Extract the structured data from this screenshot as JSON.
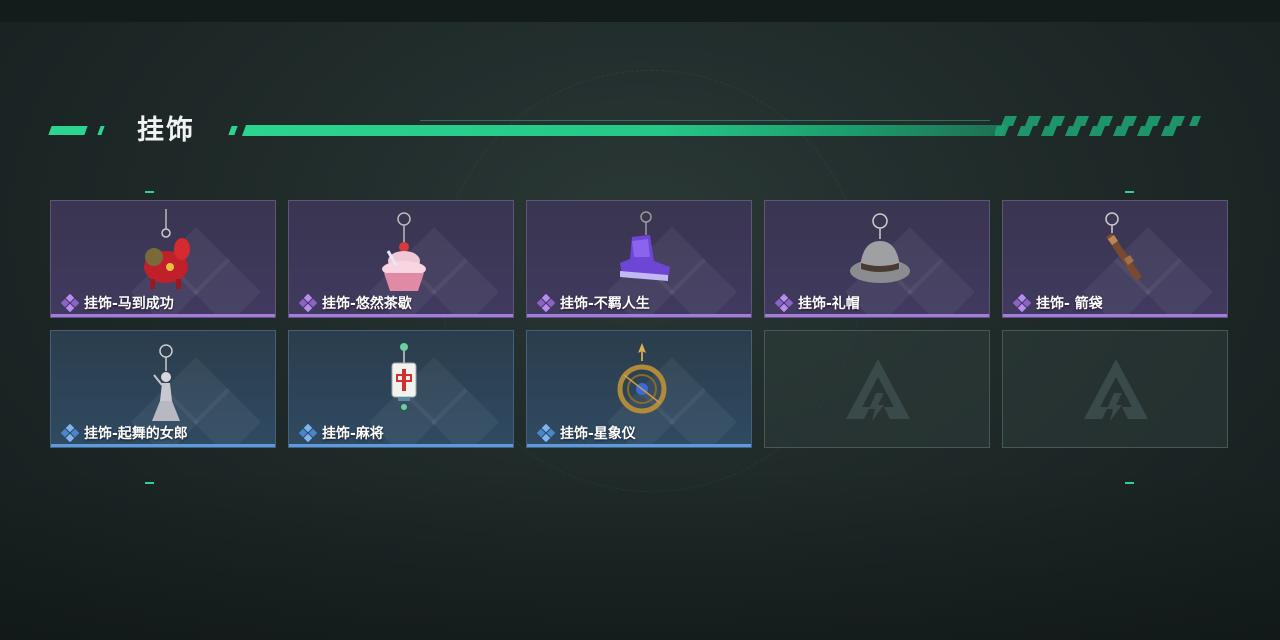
{
  "section_title": "挂饰",
  "colors": {
    "accent": "#2bd48f",
    "purple_rarity": "#a57be0",
    "blue_rarity": "#5d9be0"
  },
  "items": [
    {
      "label": "挂饰-马到成功",
      "rarity": "purple",
      "icon": "red-horse-charm-icon"
    },
    {
      "label": "挂饰-悠然茶歇",
      "rarity": "purple",
      "icon": "cupcake-charm-icon"
    },
    {
      "label": "挂饰-不羁人生",
      "rarity": "purple",
      "icon": "sneaker-charm-icon"
    },
    {
      "label": "挂饰-礼帽",
      "rarity": "purple",
      "icon": "fedora-hat-charm-icon"
    },
    {
      "label": "挂饰- 箭袋",
      "rarity": "purple",
      "icon": "quiver-charm-icon"
    },
    {
      "label": "挂饰-起舞的女郎",
      "rarity": "blue",
      "icon": "dancer-figure-charm-icon"
    },
    {
      "label": "挂饰-麻将",
      "rarity": "blue",
      "icon": "mahjong-tile-charm-icon"
    },
    {
      "label": "挂饰-星象仪",
      "rarity": "blue",
      "icon": "astrolabe-charm-icon"
    },
    {
      "label": "",
      "rarity": "empty",
      "icon": "empty-slot-logo-icon"
    },
    {
      "label": "",
      "rarity": "empty",
      "icon": "empty-slot-logo-icon"
    }
  ]
}
